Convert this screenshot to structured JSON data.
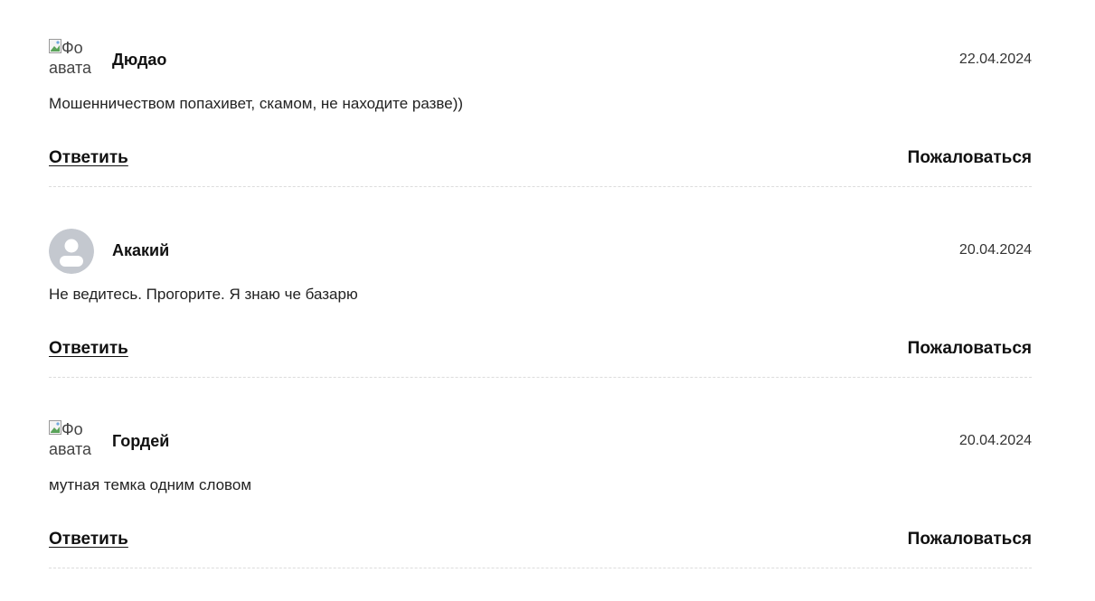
{
  "comments": [
    {
      "author": "Дюдао",
      "date": "22.04.2024",
      "text": "Мошенничеством попахивет, скамом, не находите разве))",
      "avatar_type": "broken-image",
      "avatar_alt_line1": "Фо",
      "avatar_alt_line2": "авата",
      "reply_label": "Ответить",
      "report_label": "Пожаловаться"
    },
    {
      "author": "Акакий",
      "date": "20.04.2024",
      "text": "Не ведитесь. Прогорите. Я знаю че базарю",
      "avatar_type": "default-user-icon",
      "reply_label": "Ответить",
      "report_label": "Пожаловаться"
    },
    {
      "author": "Гордей",
      "date": "20.04.2024",
      "text": "мутная темка одним словом",
      "avatar_type": "broken-image",
      "avatar_alt_line1": "Фо",
      "avatar_alt_line2": "авата",
      "reply_label": "Ответить",
      "report_label": "Пожаловаться"
    }
  ],
  "colors": {
    "text": "#111111",
    "divider": "#dcdcdc",
    "avatar_placeholder_bg": "#c4c8cf",
    "avatar_placeholder_fg": "#ffffff"
  }
}
